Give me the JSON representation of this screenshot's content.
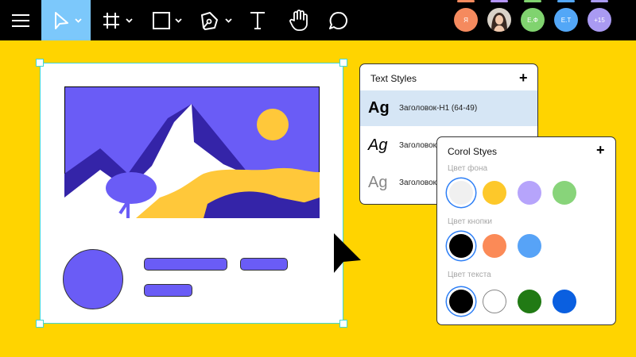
{
  "toolbar": {
    "tools": [
      {
        "name": "menu",
        "icon": "hamburger-menu-icon"
      },
      {
        "name": "move",
        "icon": "cursor-arrow-icon",
        "active": true
      },
      {
        "name": "frame",
        "icon": "frame-hash-icon"
      },
      {
        "name": "shape",
        "icon": "rectangle-icon"
      },
      {
        "name": "pen",
        "icon": "pen-tool-icon"
      },
      {
        "name": "text",
        "icon": "text-tool-icon"
      },
      {
        "name": "hand",
        "icon": "hand-icon"
      },
      {
        "name": "comment",
        "icon": "comment-bubble-icon"
      }
    ],
    "avatars": [
      {
        "label": "Я",
        "color": "#f58a5e",
        "bar": "#f58a5e"
      },
      {
        "label": "",
        "photo": true,
        "bar": "#b394f7"
      },
      {
        "label": "Е.Ф",
        "color": "#80d36f",
        "bar": "#80d36f"
      },
      {
        "label": "Е.Т",
        "color": "#53a7f7",
        "bar": "#53a7f7"
      },
      {
        "label": "+15",
        "color": "#a99af2",
        "bar": "#a99af2"
      }
    ]
  },
  "text_styles": {
    "title": "Text Styles",
    "add_icon": "+",
    "items": [
      {
        "sample": "Ag",
        "name": "Заголовок-Н1 (64-49)",
        "weight": "bold"
      },
      {
        "sample": "Ag",
        "name": "Заголовок",
        "weight": "italic"
      },
      {
        "sample": "Ag",
        "name": "Заголовок",
        "weight": "light"
      }
    ]
  },
  "color_styles": {
    "title": "Corol Styes",
    "add_icon": "+",
    "sections": [
      {
        "label": "Цвет фона",
        "colors": [
          "#f0f0f0",
          "#fdc82a",
          "#b6a4fb",
          "#88d47a"
        ],
        "selected": 0
      },
      {
        "label": "Цвет кнопки",
        "colors": [
          "#000000",
          "#fb8a57",
          "#57a3f7"
        ],
        "selected": 0
      },
      {
        "label": "Цвет текста",
        "colors": [
          "#000000",
          "#ffffff",
          "#217a14",
          "#0a5fe0"
        ],
        "selected": 0
      }
    ]
  },
  "colors": {
    "background": "#ffd400",
    "accent": "#6a5cf6",
    "selection": "#41d6d6"
  }
}
